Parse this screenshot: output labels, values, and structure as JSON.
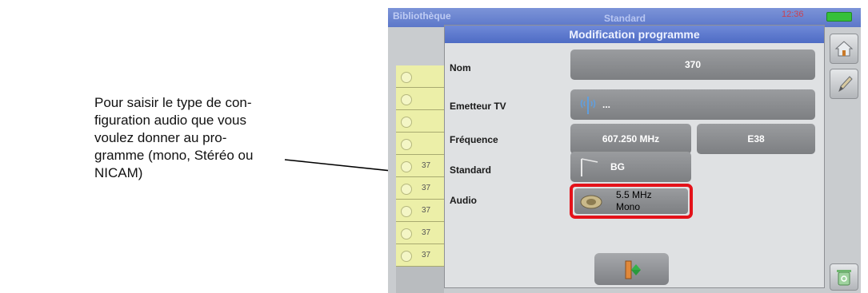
{
  "annotation": {
    "text": "Pour saisir le type de con-\nfiguration audio que vous\nvoulez donner au pro-\ngramme (mono, Stéréo ou\nNICAM)"
  },
  "device": {
    "topbar": {
      "library": "Bibliothèque",
      "standard": "Standard",
      "clock": "12:36"
    },
    "list_numbers": [
      "37",
      "37",
      "37",
      "37",
      "37"
    ],
    "dialog": {
      "title": "Modification programme",
      "rows": {
        "nom": {
          "label": "Nom",
          "value": "370"
        },
        "emetteur": {
          "label": "Emetteur TV",
          "value": "..."
        },
        "frequence": {
          "label": "Fréquence",
          "value": "607.250 MHz",
          "channel": "E38"
        },
        "standard": {
          "label": "Standard",
          "value": "BG"
        },
        "audio": {
          "label": "Audio",
          "line1": "5.5 MHz",
          "line2": "Mono"
        }
      }
    },
    "icons": {
      "home": "home-icon",
      "edit": "pencil-icon",
      "trash": "trash-icon",
      "antenna": "antenna-icon",
      "tv": "tv-icon",
      "audio": "speaker-icon",
      "ok": "confirm-icon"
    },
    "colors": {
      "highlight": "#e4121a",
      "title_bar": "#5c77c9",
      "list_row": "#ecefa8"
    }
  }
}
